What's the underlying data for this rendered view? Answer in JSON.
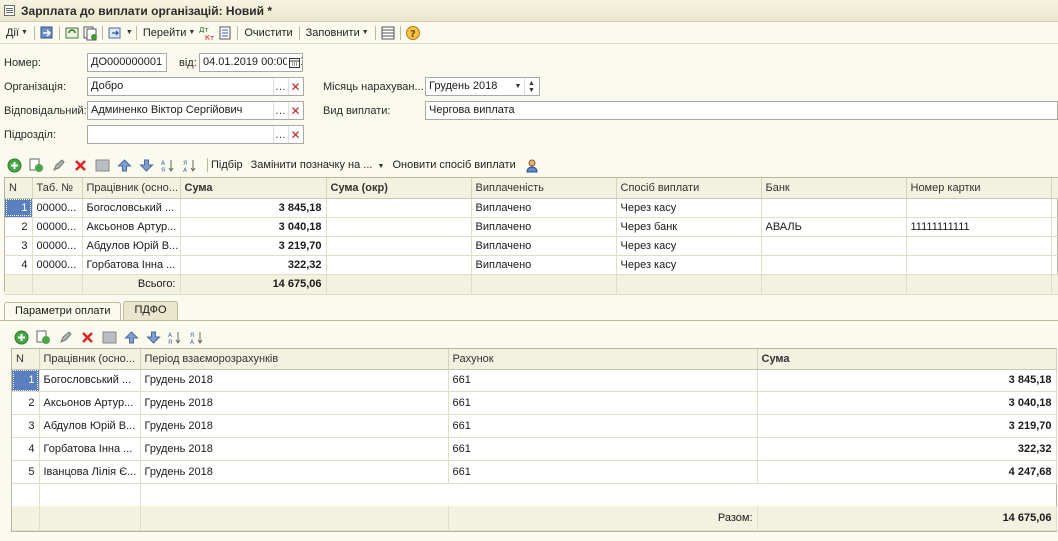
{
  "window": {
    "title": "Зарплата до виплати організацій: Новий *"
  },
  "toolbar": {
    "actions_label": "Дії",
    "goto_label": "Перейти",
    "dtkt_label": "ДтКт",
    "clear_label": "Очистити",
    "fill_label": "Заповнити"
  },
  "form": {
    "number_label": "Номер:",
    "number_value": "ДО000000001",
    "date_label": "від:",
    "date_value": "04.01.2019 00:00:00",
    "org_label": "Організація:",
    "org_value": "Добро",
    "month_label": "Місяць нарахуван...",
    "month_value": "Грудень 2018",
    "resp_label": "Відповідальний:",
    "resp_value": "Админенко Віктор Сергійович",
    "paytype_label": "Вид виплати:",
    "paytype_value": "Чергова виплата",
    "dept_label": "Підрозділ:",
    "dept_value": ""
  },
  "grid_toolbar": {
    "selection_label": "Підбір",
    "replace_label": "Замінити позначку на ...",
    "update_label": "Оновити спосіб виплати"
  },
  "main_table": {
    "columns": [
      "N",
      "Таб. №",
      "Працівник (осно...",
      "Сума",
      "Сума (окр)",
      "Виплаченість",
      "Спосіб виплати",
      "Банк",
      "Номер картки"
    ],
    "rows": [
      {
        "n": "1",
        "tab": "00000...",
        "employee": "Богословський ...",
        "sum": "3 845,18",
        "sum_round": "",
        "paid": "Виплачено",
        "method": "Через касу",
        "bank": "",
        "card": ""
      },
      {
        "n": "2",
        "tab": "00000...",
        "employee": "Аксьонов Артур...",
        "sum": "3 040,18",
        "sum_round": "",
        "paid": "Виплачено",
        "method": "Через банк",
        "bank": "АВАЛЬ",
        "card": "11111111111"
      },
      {
        "n": "3",
        "tab": "00000...",
        "employee": "Абдулов Юрій В...",
        "sum": "3 219,70",
        "sum_round": "",
        "paid": "Виплачено",
        "method": "Через касу",
        "bank": "",
        "card": ""
      },
      {
        "n": "4",
        "tab": "00000...",
        "employee": "Горбатова Інна ...",
        "sum": "322,32",
        "sum_round": "",
        "paid": "Виплачено",
        "method": "Через касу",
        "bank": "",
        "card": ""
      }
    ],
    "total_label": "Всього:",
    "total_value": "14 675,06"
  },
  "tabs": [
    "Параметри оплати",
    "ПДФО"
  ],
  "params_table": {
    "columns": [
      "N",
      "Працівник (осно...",
      "Період взаєморозрахунків",
      "Рахунок",
      "Сума"
    ],
    "rows": [
      {
        "n": "1",
        "employee": "Богословський ...",
        "period": "Грудень 2018",
        "account": "661",
        "sum": "3 845,18"
      },
      {
        "n": "2",
        "employee": "Аксьонов Артур...",
        "period": "Грудень 2018",
        "account": "661",
        "sum": "3 040,18"
      },
      {
        "n": "3",
        "employee": "Абдулов Юрій В...",
        "period": "Грудень 2018",
        "account": "661",
        "sum": "3 219,70"
      },
      {
        "n": "4",
        "employee": "Горбатова Інна ...",
        "period": "Грудень 2018",
        "account": "661",
        "sum": "322,32"
      },
      {
        "n": "5",
        "employee": "Іванцова Лілія Є...",
        "period": "Грудень 2018",
        "account": "661",
        "sum": "4 247,68"
      }
    ],
    "total_label": "Разом:",
    "total_value": "14 675,06"
  },
  "icons": {
    "add": "add-icon",
    "copy": "copy-icon",
    "edit": "edit-icon",
    "delete": "delete-icon",
    "end-edit": "end-edit-icon",
    "up": "move-up-icon",
    "down": "move-down-icon",
    "sort-asc": "sort-asc-icon",
    "sort-desc": "sort-desc-icon",
    "help": "help-icon"
  }
}
